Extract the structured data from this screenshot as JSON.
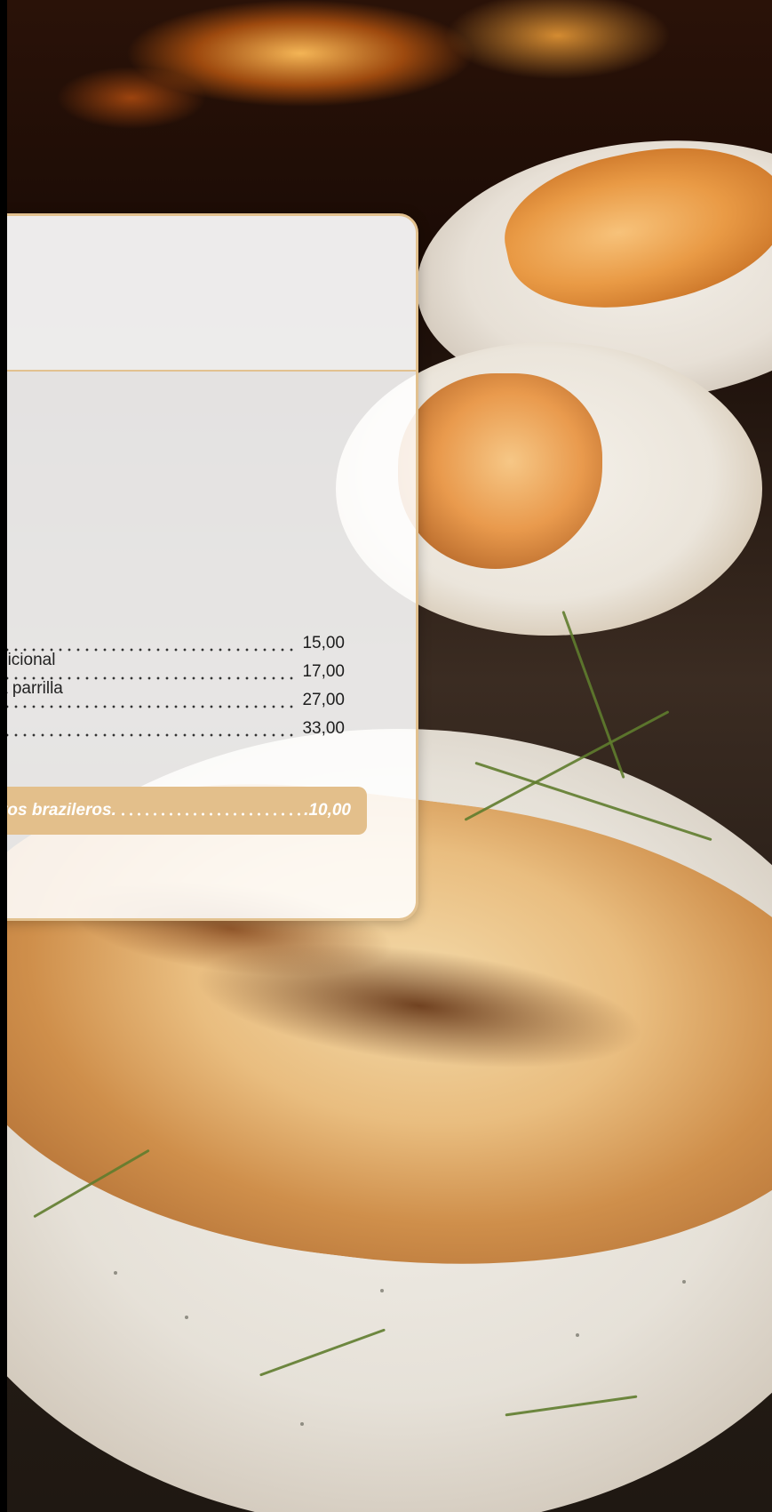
{
  "menu": {
    "prices": [
      {
        "price": "15,00"
      },
      {
        "price": "17,00"
      },
      {
        "price": "27,00"
      },
      {
        "price": "33,00"
      }
    ],
    "descriptions": [
      "dicional",
      "a parrilla"
    ],
    "promo": {
      "label": "nientos brazileros.",
      "price": ".10,00"
    }
  },
  "colors": {
    "accent": "#e3bf8b",
    "card_bg": "#ffffff",
    "text": "#1d1d1d"
  }
}
